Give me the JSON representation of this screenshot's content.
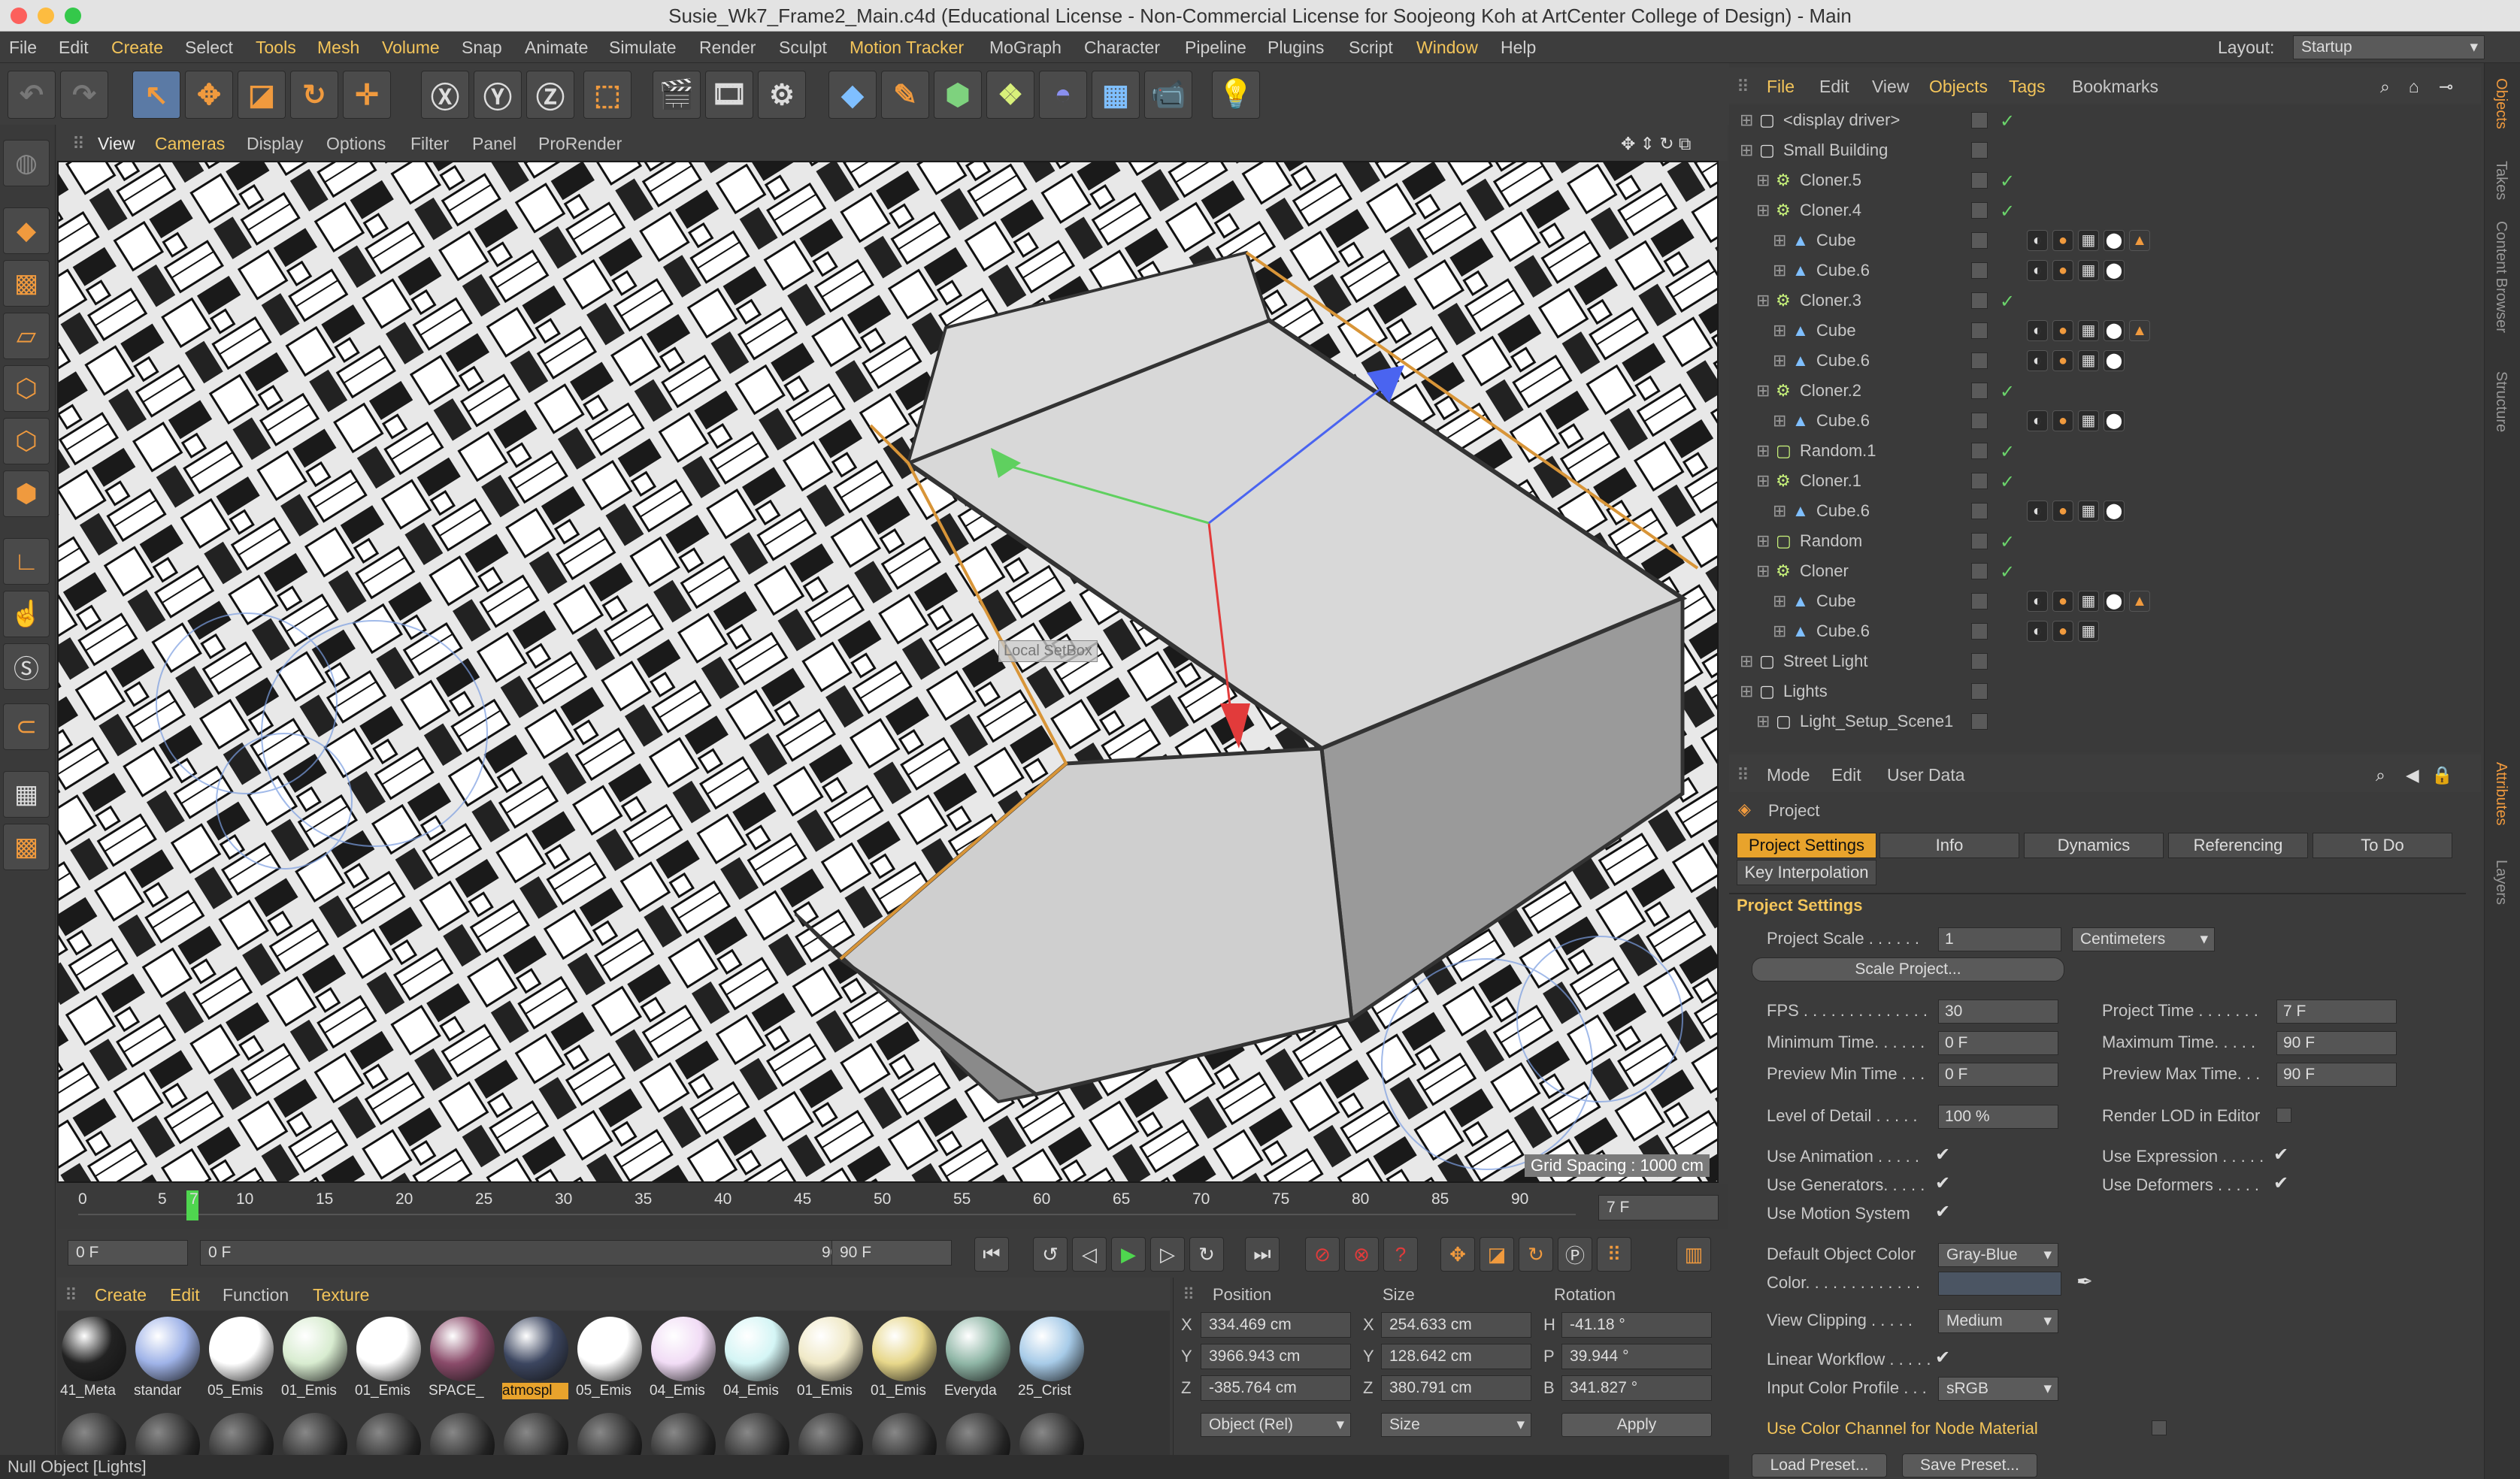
{
  "window": {
    "title": "Susie_Wk7_Frame2_Main.c4d (Educational License - Non-Commercial License for Soojeong Koh at ArtCenter College of Design) - Main"
  },
  "menubar": {
    "items": [
      "File",
      "Edit",
      "Create",
      "Select",
      "Tools",
      "Mesh",
      "Volume",
      "Snap",
      "Animate",
      "Simulate",
      "Render",
      "Sculpt",
      "Motion Tracker",
      "MoGraph",
      "Character",
      "Pipeline",
      "Plugins",
      "Script",
      "Window",
      "Help"
    ],
    "layout_label": "Layout:",
    "layout_value": "Startup"
  },
  "viewport": {
    "menu": [
      "View",
      "Cameras",
      "Display",
      "Options",
      "Filter",
      "Panel",
      "ProRender"
    ],
    "grid_spacing": "Grid Spacing : 1000 cm",
    "overlay_label": "Local SetBox"
  },
  "timeline": {
    "ticks": [
      "0",
      "5",
      "7",
      "10",
      "15",
      "20",
      "25",
      "30",
      "35",
      "40",
      "45",
      "50",
      "55",
      "60",
      "65",
      "70",
      "75",
      "80",
      "85",
      "90"
    ],
    "current_frame": "7 F",
    "start": "0 F",
    "range_start": "0 F",
    "range_end": "90 F",
    "end": "90 F"
  },
  "materials": {
    "menu": [
      "Create",
      "Edit",
      "Function",
      "Texture"
    ],
    "items": [
      {
        "label": "41_Meta",
        "color": "#222"
      },
      {
        "label": "standar",
        "color": "#9fb3e8"
      },
      {
        "label": "05_Emis",
        "color": "#ffffff"
      },
      {
        "label": "01_Emis",
        "color": "#d8ecd0"
      },
      {
        "label": "01_Emis",
        "color": "#ffffff"
      },
      {
        "label": "SPACE_",
        "color": "#8a4b6a"
      },
      {
        "label": "atmospl",
        "color": "#3c4660"
      },
      {
        "label": "05_Emis",
        "color": "#ffffff"
      },
      {
        "label": "04_Emis",
        "color": "#f1dcf5"
      },
      {
        "label": "04_Emis",
        "color": "#d4f5f5"
      },
      {
        "label": "01_Emis",
        "color": "#f0e9c7"
      },
      {
        "label": "01_Emis",
        "color": "#e7d78a"
      },
      {
        "label": "Everyda",
        "color": "#8fb6a6"
      },
      {
        "label": "25_Crist",
        "color": "#a7cbe8"
      }
    ],
    "selected_index": 6
  },
  "coordinates": {
    "headers": [
      "Position",
      "Size",
      "Rotation"
    ],
    "rows": [
      {
        "axis": "X",
        "pos": "334.469 cm",
        "saxis": "X",
        "size": "254.633 cm",
        "raxis": "H",
        "rot": "-41.18 °"
      },
      {
        "axis": "Y",
        "pos": "3966.943 cm",
        "saxis": "Y",
        "size": "128.642 cm",
        "raxis": "P",
        "rot": "39.944 °"
      },
      {
        "axis": "Z",
        "pos": "-385.764 cm",
        "saxis": "Z",
        "size": "380.791 cm",
        "raxis": "B",
        "rot": "341.827 °"
      }
    ],
    "mode": "Object (Rel)",
    "size_mode": "Size",
    "apply": "Apply"
  },
  "status": {
    "text": "Null Object [Lights]"
  },
  "object_manager": {
    "menu": [
      "File",
      "Edit",
      "View",
      "Objects",
      "Tags",
      "Bookmarks"
    ],
    "rows": [
      {
        "name": "<display driver>",
        "indent": 0,
        "check": true
      },
      {
        "name": "Small Building",
        "indent": 0,
        "check": false
      },
      {
        "name": "Cloner.5",
        "indent": 1,
        "check": true
      },
      {
        "name": "Cloner.4",
        "indent": 1,
        "check": true
      },
      {
        "name": "Cube",
        "indent": 2,
        "check": false,
        "tags": 5
      },
      {
        "name": "Cube.6",
        "indent": 2,
        "check": false,
        "tags": 4
      },
      {
        "name": "Cloner.3",
        "indent": 1,
        "check": true
      },
      {
        "name": "Cube",
        "indent": 2,
        "check": false,
        "tags": 5
      },
      {
        "name": "Cube.6",
        "indent": 2,
        "check": false,
        "tags": 4
      },
      {
        "name": "Cloner.2",
        "indent": 1,
        "check": true
      },
      {
        "name": "Cube.6",
        "indent": 2,
        "check": false,
        "tags": 4
      },
      {
        "name": "Random.1",
        "indent": 1,
        "check": true
      },
      {
        "name": "Cloner.1",
        "indent": 1,
        "check": true
      },
      {
        "name": "Cube.6",
        "indent": 2,
        "check": false,
        "tags": 4
      },
      {
        "name": "Random",
        "indent": 1,
        "check": true
      },
      {
        "name": "Cloner",
        "indent": 1,
        "check": true
      },
      {
        "name": "Cube",
        "indent": 2,
        "check": false,
        "tags": 5
      },
      {
        "name": "Cube.6",
        "indent": 2,
        "check": false,
        "tags": 3
      },
      {
        "name": "Street Light",
        "indent": 0,
        "check": false
      },
      {
        "name": "Lights",
        "indent": 0,
        "check": false
      },
      {
        "name": "Light_Setup_Scene1",
        "indent": 1,
        "check": false
      }
    ]
  },
  "attributes": {
    "menu": [
      "Mode",
      "Edit",
      "User Data"
    ],
    "object": "Project",
    "tabs": [
      "Project Settings",
      "Info",
      "Dynamics",
      "Referencing",
      "To Do"
    ],
    "tab2": "Key Interpolation",
    "section": "Project Settings",
    "project_scale_label": "Project Scale . . . . . .",
    "project_scale": "1",
    "units": "Centimeters",
    "scale_button": "Scale Project...",
    "fps_label": "FPS . . . . . . . . . . . . . .",
    "fps": "30",
    "project_time_label": "Project Time . . . . . . .",
    "project_time": "7 F",
    "min_time_label": "Minimum Time. . . . . .",
    "min_time": "0 F",
    "max_time_label": "Maximum Time. . . . .",
    "max_time": "90 F",
    "prev_min_label": "Preview Min Time . . .",
    "prev_min": "0 F",
    "prev_max_label": "Preview Max Time. . .",
    "prev_max": "90 F",
    "lod_label": "Level of Detail . . . . .",
    "lod": "100 %",
    "render_lod_label": "Render LOD in Editor",
    "use_anim_label": "Use Animation . . . . .",
    "use_expr_label": "Use Expression . . . . .",
    "use_gen_label": "Use Generators. . . . .",
    "use_def_label": "Use Deformers . . . . .",
    "use_motion_label": "Use Motion System",
    "def_color_label": "Default Object Color",
    "def_color": "Gray-Blue",
    "color_label": "Color. . . . . . . . . . . . .",
    "view_clip_label": "View Clipping . . . . .",
    "view_clip": "Medium",
    "linear_label": "Linear Workflow . . . . .",
    "input_profile_label": "Input Color Profile . . .",
    "input_profile": "sRGB",
    "node_material_label": "Use Color Channel for Node Material",
    "load_preset": "Load Preset...",
    "save_preset": "Save Preset..."
  },
  "side_tabs": [
    "Objects",
    "Takes",
    "Content Browser",
    "Structure",
    "Attributes",
    "Layers"
  ]
}
